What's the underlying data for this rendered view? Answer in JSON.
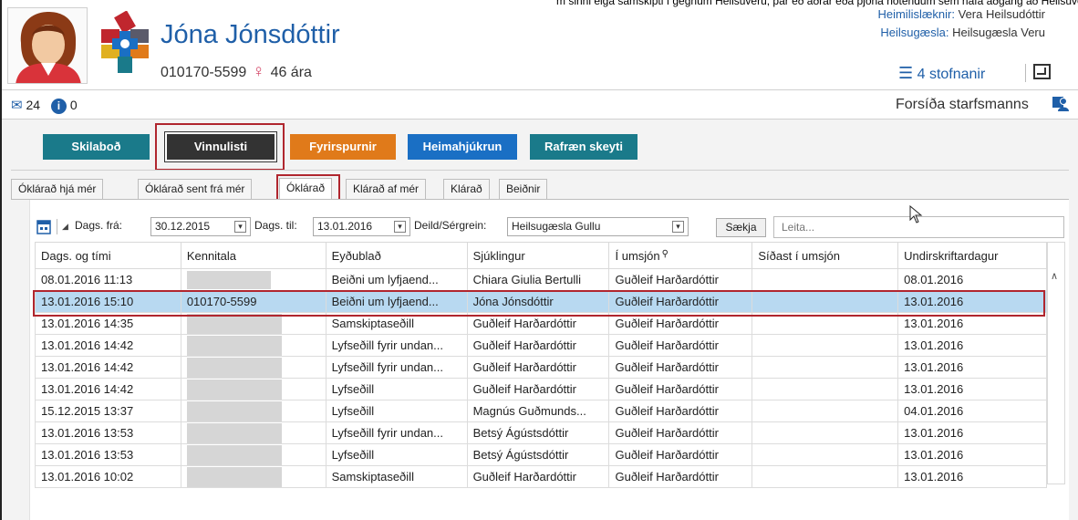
{
  "top_strip_text": "m sinni eiga samskipti í gegnum Heilsuveru, þar eð aðrar eða þjóna notendum sem hafa aðgang að Heilsuveru.",
  "patient": {
    "name": "Jóna Jónsdóttir",
    "kennitala": "010170-5599",
    "gender_icon": "female-icon",
    "age": "46 ára"
  },
  "doctor": {
    "label": "Heimilislæknir:",
    "value": "Vera Heilsudóttir"
  },
  "clinic": {
    "label": "Heilsugæsla:",
    "value": "Heilsugæsla Veru"
  },
  "stofnanir_label": "4 stofnanir",
  "mail_count": "24",
  "info_count": "0",
  "forsida_label": "Forsíða starfsmanns",
  "buttons": [
    {
      "label": "Skilaboð",
      "color": "#1a7a8a"
    },
    {
      "label": "Vinnulisti",
      "color": "#333333"
    },
    {
      "label": "Fyrirspurnir",
      "color": "#e07a1a"
    },
    {
      "label": "Heimahjúkrun",
      "color": "#1a6fc4"
    },
    {
      "label": "Rafræn skeyti",
      "color": "#1a7a8a"
    }
  ],
  "tabs": [
    {
      "label": "Óklárað hjá mér"
    },
    {
      "label": "Óklárað sent frá mér"
    },
    {
      "label": "Óklárað"
    },
    {
      "label": "Klárað af mér"
    },
    {
      "label": "Klárað"
    },
    {
      "label": "Beiðnir"
    }
  ],
  "filters": {
    "from_label": "Dags. frá:",
    "from_value": "30.12.2015",
    "to_label": "Dags. til:",
    "to_value": "13.01.2016",
    "dept_label": "Deild/Sérgrein:",
    "dept_value": "Heilsugæsla Gullu",
    "fetch_label": "Sækja",
    "search_placeholder": "Leita..."
  },
  "table": {
    "headers": [
      "Dags. og tími",
      "Kennitala",
      "Eyðublað",
      "Sjúklingur",
      "Í umsjón",
      "Síðast í umsjón",
      "Undirskriftardagur"
    ],
    "rows": [
      [
        "08.01.2016 11:13",
        "",
        "Beiðni um lyfjaend...",
        "Chiara Giulia Bertulli",
        "Guðleif Harðardóttir",
        "",
        "08.01.2016"
      ],
      [
        "13.01.2016 15:10",
        "010170-5599",
        "Beiðni um lyfjaend...",
        "Jóna Jónsdóttir",
        "Guðleif Harðardóttir",
        "",
        "13.01.2016"
      ],
      [
        "13.01.2016 14:35",
        "",
        "Samskiptaseðill",
        "Guðleif Harðardóttir",
        "Guðleif Harðardóttir",
        "",
        "13.01.2016"
      ],
      [
        "13.01.2016 14:42",
        "",
        "Lyfseðill fyrir undan...",
        "Guðleif Harðardóttir",
        "Guðleif Harðardóttir",
        "",
        "13.01.2016"
      ],
      [
        "13.01.2016 14:42",
        "",
        "Lyfseðill fyrir undan...",
        "Guðleif Harðardóttir",
        "Guðleif Harðardóttir",
        "",
        "13.01.2016"
      ],
      [
        "13.01.2016 14:42",
        "",
        "Lyfseðill",
        "Guðleif Harðardóttir",
        "Guðleif Harðardóttir",
        "",
        "13.01.2016"
      ],
      [
        "15.12.2015 13:37",
        "",
        "Lyfseðill",
        "Magnús Guðmunds...",
        "Guðleif Harðardóttir",
        "",
        "04.01.2016"
      ],
      [
        "13.01.2016 13:53",
        "",
        "Lyfseðill fyrir undan...",
        "Betsý Ágústsdóttir",
        "Guðleif Harðardóttir",
        "",
        "13.01.2016"
      ],
      [
        "13.01.2016 13:53",
        "",
        "Lyfseðill",
        "Betsý Ágústsdóttir",
        "Guðleif Harðardóttir",
        "",
        "13.01.2016"
      ],
      [
        "13.01.2016 10:02",
        "",
        "Samskiptaseðill",
        "Guðleif Harðardóttir",
        "Guðleif Harðardóttir",
        "",
        "13.01.2016"
      ]
    ]
  }
}
